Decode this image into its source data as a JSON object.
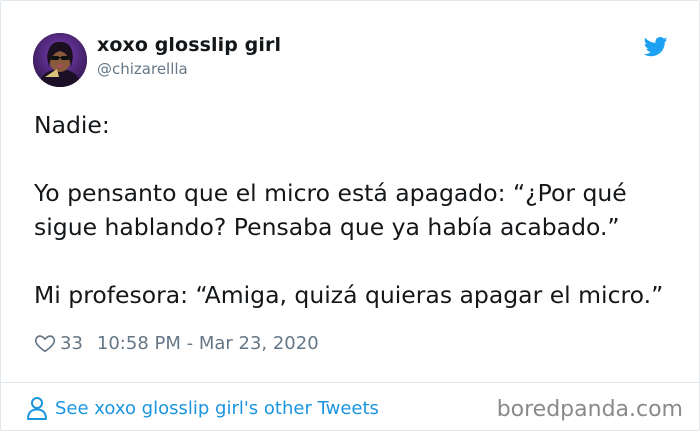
{
  "tweet": {
    "display_name": "xoxo glosslip girl",
    "handle": "@chizarellla",
    "lines": {
      "l1": "Nadie:",
      "l2": "Yo pensanto que el micro está apagado: “¿Por qué",
      "l3": "sigue hablando? Pensaba que ya había acabado.”",
      "l4": "Mi profesora: “Amiga, quizá quieras apagar el micro.”"
    },
    "likes": "33",
    "timestamp": "10:58 PM - Mar 23, 2020",
    "see_more": "See xoxo glosslip girl's other Tweets"
  },
  "watermark": "boredpanda.com",
  "colors": {
    "twitter_blue": "#1da1f2",
    "link_blue": "#1b95e0",
    "text": "#14171a",
    "muted": "#657786",
    "border": "#e1e8ed"
  },
  "icons": {
    "brand": "twitter-bird-icon",
    "like": "heart-icon",
    "profile": "person-icon"
  }
}
